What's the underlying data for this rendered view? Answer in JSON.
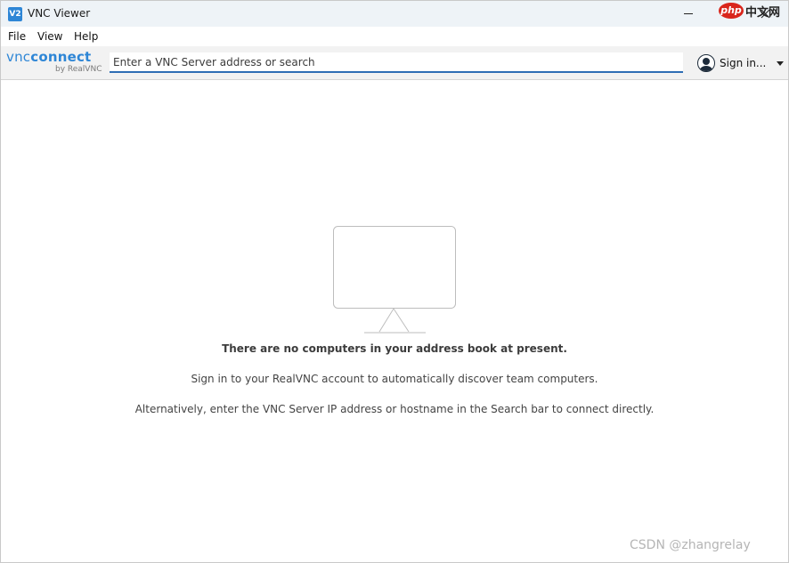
{
  "window": {
    "title": "VNC Viewer",
    "icon_text": "V2"
  },
  "watermark": {
    "badge": "php",
    "text": "中文网",
    "footer": "CSDN @zhangrelay"
  },
  "menu": {
    "items": [
      "File",
      "View",
      "Help"
    ]
  },
  "toolbar": {
    "logo_main_a": "vnc",
    "logo_main_b": "connect",
    "logo_sub": "by RealVNC",
    "search_placeholder": "Enter a VNC Server address or search",
    "search_value": "",
    "signin_label": "Sign in..."
  },
  "main": {
    "empty_title": "There are no computers in your address book at present.",
    "empty_line1": "Sign in to your RealVNC account to automatically discover team computers.",
    "empty_line2": "Alternatively, enter the VNC Server IP address or hostname in the Search bar to connect directly."
  },
  "colors": {
    "accent": "#2e86d6",
    "underline": "#2e6db4"
  }
}
